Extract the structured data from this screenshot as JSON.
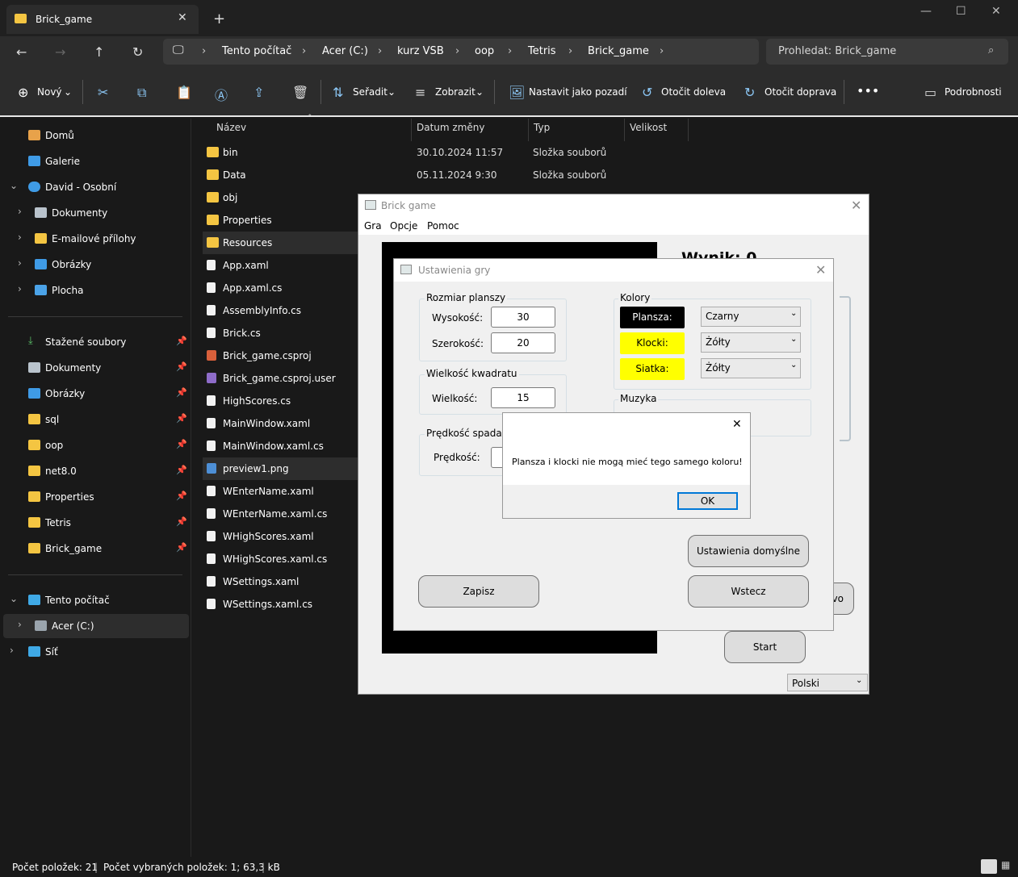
{
  "tab": {
    "title": "Brick_game"
  },
  "address": {
    "crumbs": [
      "Tento počítač",
      "Acer (C:)",
      "kurz VSB",
      "oop",
      "Tetris",
      "Brick_game"
    ],
    "search_placeholder": "Prohledat: Brick_game"
  },
  "toolbar": {
    "new": "Nový",
    "sort": "Seřadit",
    "view": "Zobrazit",
    "set_background": "Nastavit jako pozadí",
    "rotate_left": "Otočit doleva",
    "rotate_right": "Otočit doprava",
    "details": "Podrobnosti"
  },
  "sidebar": {
    "top": [
      "Domů",
      "Galerie",
      "David - Osobní",
      "Dokumenty",
      "E-mailové přílohy",
      "Obrázky",
      "Plocha"
    ],
    "quick": [
      "Stažené soubory",
      "Dokumenty",
      "Obrázky",
      "sql",
      "oop",
      "net8.0",
      "Properties",
      "Tetris",
      "Brick_game"
    ],
    "bottom": [
      "Tento počítač",
      "Acer (C:)",
      "Síť"
    ]
  },
  "list": {
    "columns": [
      "Název",
      "Datum změny",
      "Typ",
      "Velikost"
    ],
    "files": [
      {
        "name": "bin",
        "date": "30.10.2024 11:57",
        "type": "Složka souborů"
      },
      {
        "name": "Data",
        "date": "05.11.2024 9:30",
        "type": "Složka souborů"
      },
      {
        "name": "obj"
      },
      {
        "name": "Properties"
      },
      {
        "name": "Resources"
      },
      {
        "name": "App.xaml"
      },
      {
        "name": "App.xaml.cs"
      },
      {
        "name": "AssemblyInfo.cs"
      },
      {
        "name": "Brick.cs"
      },
      {
        "name": "Brick_game.csproj"
      },
      {
        "name": "Brick_game.csproj.user"
      },
      {
        "name": "HighScores.cs"
      },
      {
        "name": "MainWindow.xaml"
      },
      {
        "name": "MainWindow.xaml.cs"
      },
      {
        "name": "preview1.png"
      },
      {
        "name": "WEnterName.xaml"
      },
      {
        "name": "WEnterName.xaml.cs"
      },
      {
        "name": "WHighScores.xaml"
      },
      {
        "name": "WHighScores.xaml.cs"
      },
      {
        "name": "WSettings.xaml"
      },
      {
        "name": "WSettings.xaml.cs"
      }
    ]
  },
  "status": {
    "count": "Počet položek: 21",
    "selected": "Počet vybraných položek: 1; 63,3 kB"
  },
  "game": {
    "title": "Brick game",
    "menu": [
      "Gra",
      "Opcje",
      "Pomoc"
    ],
    "score": "Wynik: 0",
    "partial_button": "vo",
    "start": "Start",
    "language": "Polski"
  },
  "settings": {
    "title": "Ustawienia gry",
    "board_size": {
      "label": "Rozmiar planszy",
      "height_label": "Wysokość:",
      "height": "30",
      "width_label": "Szerokość:",
      "width": "20"
    },
    "square": {
      "label": "Wielkość kwadratu",
      "size_label": "Wielkość:",
      "size": "15"
    },
    "speed": {
      "label": "Prędkość spadania",
      "speed_label": "Prędkość:"
    },
    "colors": {
      "label": "Kolory",
      "rows": [
        {
          "name": "Plansza:",
          "value": "Czarny",
          "swatch": "#000000",
          "text": "#ffffff"
        },
        {
          "name": "Klocki:",
          "value": "Żółty",
          "swatch": "#ffff00",
          "text": "#000000"
        },
        {
          "name": "Siatka:",
          "value": "Żółty",
          "swatch": "#ffff00",
          "text": "#000000"
        }
      ]
    },
    "music": {
      "label": "Muzyka"
    },
    "defaults": "Ustawienia domyślne",
    "save": "Zapisz",
    "back": "Wstecz"
  },
  "message": {
    "text": "Plansza i klocki nie mogą mieć tego samego koloru!",
    "ok": "OK"
  }
}
